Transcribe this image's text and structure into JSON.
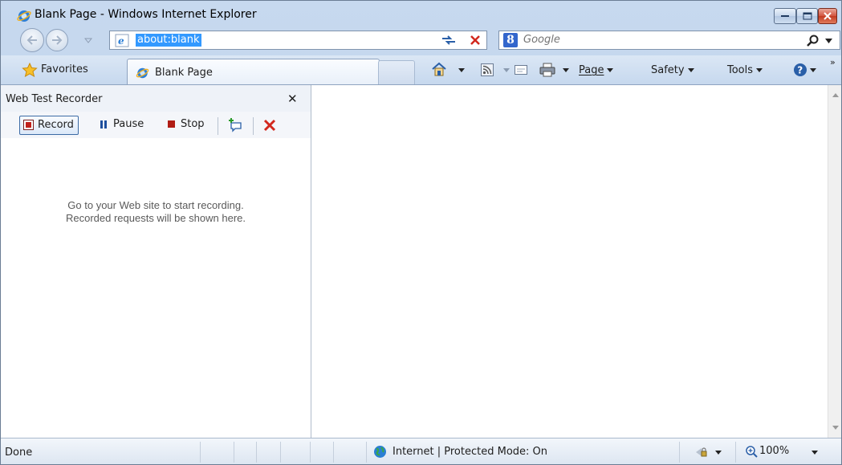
{
  "window": {
    "title": "Blank Page - Windows Internet Explorer"
  },
  "address_bar": {
    "value": "about:blank"
  },
  "search": {
    "placeholder": "Google"
  },
  "tabs": [
    {
      "label": "Blank Page",
      "active": true
    }
  ],
  "command_bar": {
    "favorites_label": "Favorites",
    "page_label": "Page",
    "safety_label": "Safety",
    "tools_label": "Tools"
  },
  "recorder_panel": {
    "title": "Web Test Recorder",
    "record_label": "Record",
    "pause_label": "Pause",
    "stop_label": "Stop",
    "message_line1": "Go to your Web site to start recording.",
    "message_line2": "Recorded requests will be shown here."
  },
  "status_bar": {
    "status": "Done",
    "zone": "Internet | Protected Mode: On",
    "zoom": "100%"
  },
  "colors": {
    "selection": "#3399ff",
    "close_button": "#c23b22",
    "record_red": "#c0201a",
    "pause_blue": "#1d4f9e"
  }
}
